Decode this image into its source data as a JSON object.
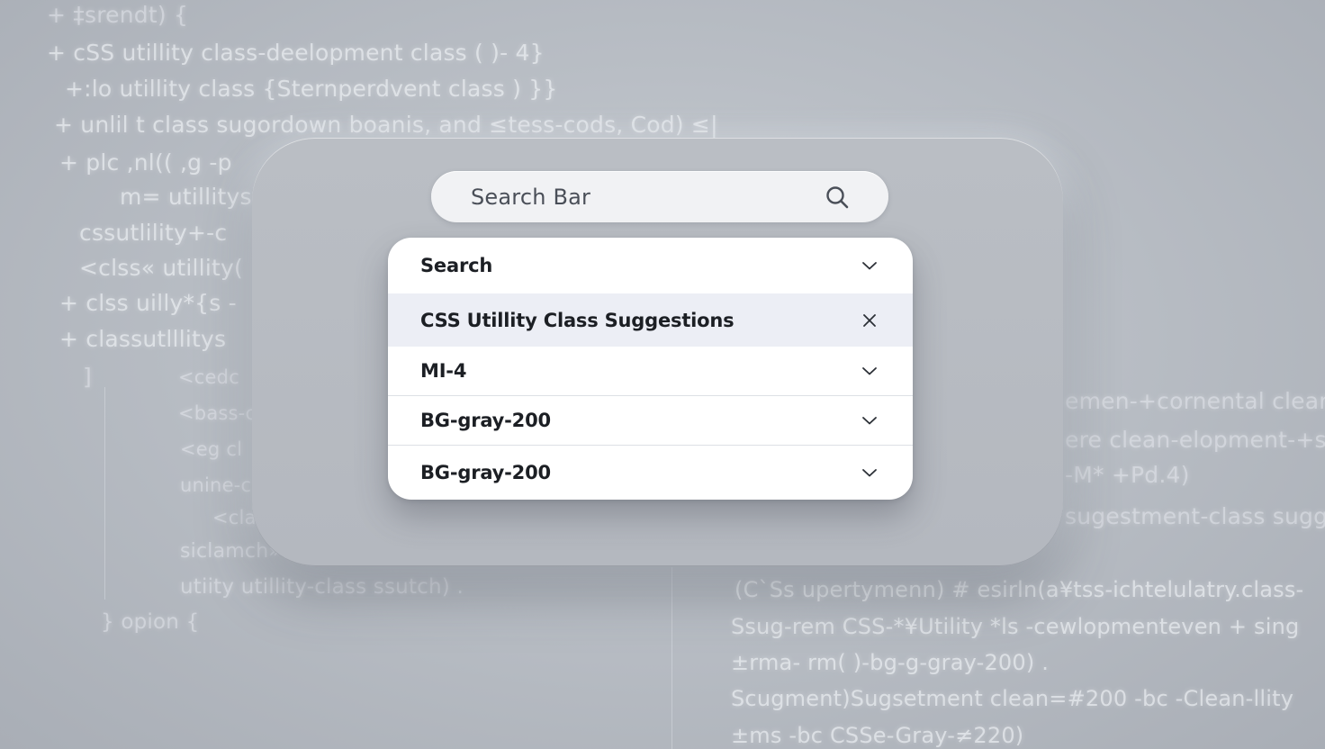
{
  "background_code": {
    "left_lines": [
      "+ ‡srendt) {",
      "+ cSS utillity class-deelopment class ( )- 4}",
      "+:lo utillity class {Sternperdvent  class  ) }}",
      "+ unlil t class sugordown boanis, and ≤tess-cods, Cod) ≤|",
      "+ plc ,nl(( ,g -p",
      "m= utillitys",
      "cssutlility+-c",
      "<clss« utillity(",
      "+ clss uilly*{s -",
      "+ classutlllitys",
      "]",
      "<cedc",
      "<bass-c",
      "<eg cl",
      "unine-c",
      "<clar",
      "siclamch»",
      "utiity utillity-class ssutch) .",
      "}    opion  {"
    ],
    "right_lines": [
      "emen-+cornental clean",
      "ere  clean-elopment-+s",
      "-M* +Pd.4)",
      "sugestment-class sugge",
      "(C`Ss upertymenn) # esirln(a¥tss-ichtelulatry.class-",
      "Ssug-rem CSS-*¥Utility *ls -cewlopmenteven  + sing",
      "±rma- rm( )-bg-g-gray-200) .",
      "Scugment)Sugsetment clean=#200 -bc -Clean-llity",
      "±ms -bc  CSSe-Gray-≠220)"
    ]
  },
  "search": {
    "placeholder": "Search Bar",
    "icon": "search-icon"
  },
  "dropdown": {
    "items": [
      {
        "label": "Search",
        "icon": "chevron-down-icon",
        "selected": false
      },
      {
        "label": "CSS Utillity Class Suggestions",
        "icon": "close-icon",
        "selected": true
      },
      {
        "label": "MI-4",
        "icon": "chevron-down-icon",
        "selected": false
      },
      {
        "label": "BG-gray-200",
        "icon": "chevron-down-icon",
        "selected": false
      },
      {
        "label": "BG-gray-200",
        "icon": "chevron-down-icon",
        "selected": false
      }
    ]
  },
  "colors": {
    "selected_row": "#eceef5",
    "panel": "#b8bcc2",
    "background": "#b9bec5"
  }
}
